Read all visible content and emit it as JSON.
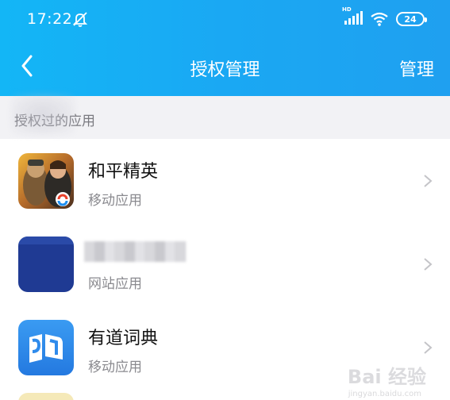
{
  "status_bar": {
    "time": "17:22",
    "network_label": "HD",
    "battery_level": "24"
  },
  "nav": {
    "title": "授权管理",
    "manage_label": "管理"
  },
  "section": {
    "label": "授权过的应用"
  },
  "apps": [
    {
      "name": "和平精英",
      "type": "移动应用",
      "icon": "game-icon"
    },
    {
      "name": "",
      "type": "网站应用",
      "icon": "website-icon"
    },
    {
      "name": "有道词典",
      "type": "移动应用",
      "icon": "dictionary-icon"
    }
  ],
  "watermark": {
    "text": "Bai 经验",
    "sub": "jingyan.baidu.com"
  },
  "colors": {
    "header": "#1aa8f3",
    "section_bg": "#f2f2f5",
    "website_icon": "#1f3a93",
    "dictionary_icon": "#2f8bec"
  }
}
